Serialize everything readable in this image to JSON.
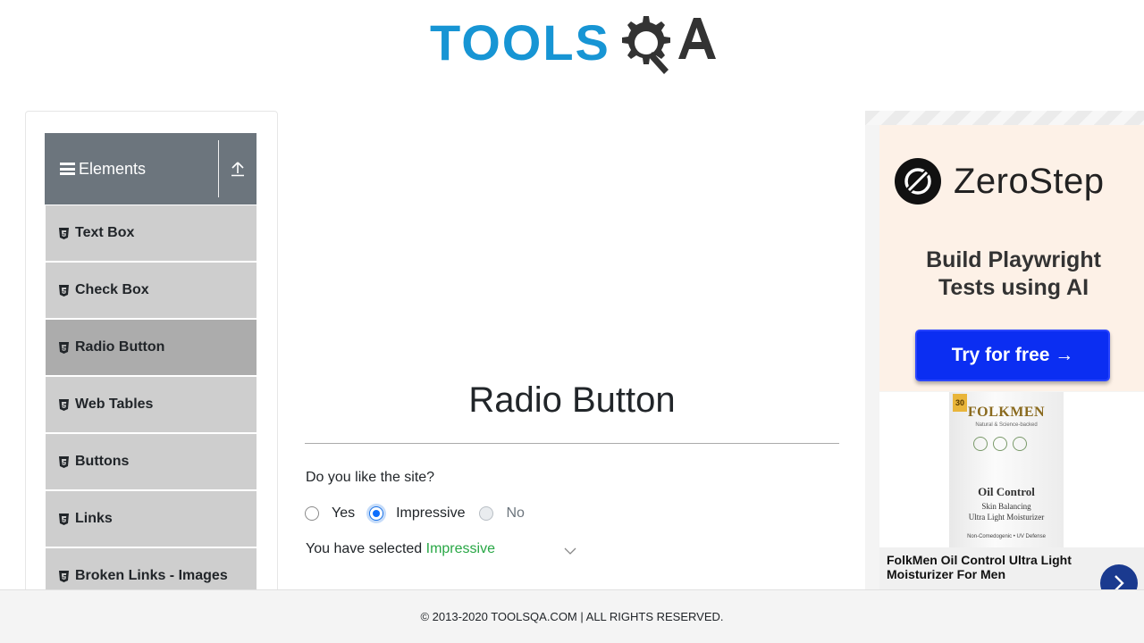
{
  "header": {
    "logo_text": "TOOLS",
    "logo_suffix": "QA"
  },
  "sidebar": {
    "group": {
      "title": "Elements",
      "icon": "hamburger-icon",
      "toggle_icon": "collapse-arrow-icon"
    },
    "items": [
      {
        "label": "Text Box",
        "icon": "html5-icon",
        "active": false
      },
      {
        "label": "Check Box",
        "icon": "html5-icon",
        "active": false
      },
      {
        "label": "Radio Button",
        "icon": "html5-icon",
        "active": true
      },
      {
        "label": "Web Tables",
        "icon": "html5-icon",
        "active": false
      },
      {
        "label": "Buttons",
        "icon": "html5-icon",
        "active": false
      },
      {
        "label": "Links",
        "icon": "html5-icon",
        "active": false
      },
      {
        "label": "Broken Links - Images",
        "icon": "html5-icon",
        "active": false
      }
    ]
  },
  "main": {
    "title": "Radio Button",
    "question": "Do you like the site?",
    "options": [
      {
        "label": "Yes",
        "checked": false,
        "disabled": false
      },
      {
        "label": "Impressive",
        "checked": true,
        "disabled": false
      },
      {
        "label": "No",
        "checked": false,
        "disabled": true
      }
    ],
    "result_prefix": "You have selected ",
    "result_value": "Impressive"
  },
  "ad": {
    "brand": "ZeroStep",
    "tagline_line1": "Build Playwright",
    "tagline_line2": "Tests using AI",
    "cta": "Try for free →",
    "product": {
      "badge": "30",
      "brand": "FOLKMEN",
      "sub": "Natural & Science-backed",
      "name": "Oil Control",
      "desc_line1": "Skin Balancing",
      "desc_line2": "Ultra Light Moisturizer",
      "fine": "Non-Comedogenic • UV Defense"
    },
    "caption": "FolkMen Oil Control Ultra Light Moisturizer For Men",
    "next_icon": "chevron-right-icon"
  },
  "footer": {
    "text": "© 2013-2020 TOOLSQA.COM | ALL RIGHTS RESERVED."
  },
  "colors": {
    "logo_blue": "#1795d4",
    "logo_dark": "#333333",
    "group_header": "#6c757d",
    "menu_item": "#cecece",
    "menu_active": "#acacac",
    "selected_text": "#28a745",
    "cta_blue": "#0b2ef2"
  }
}
